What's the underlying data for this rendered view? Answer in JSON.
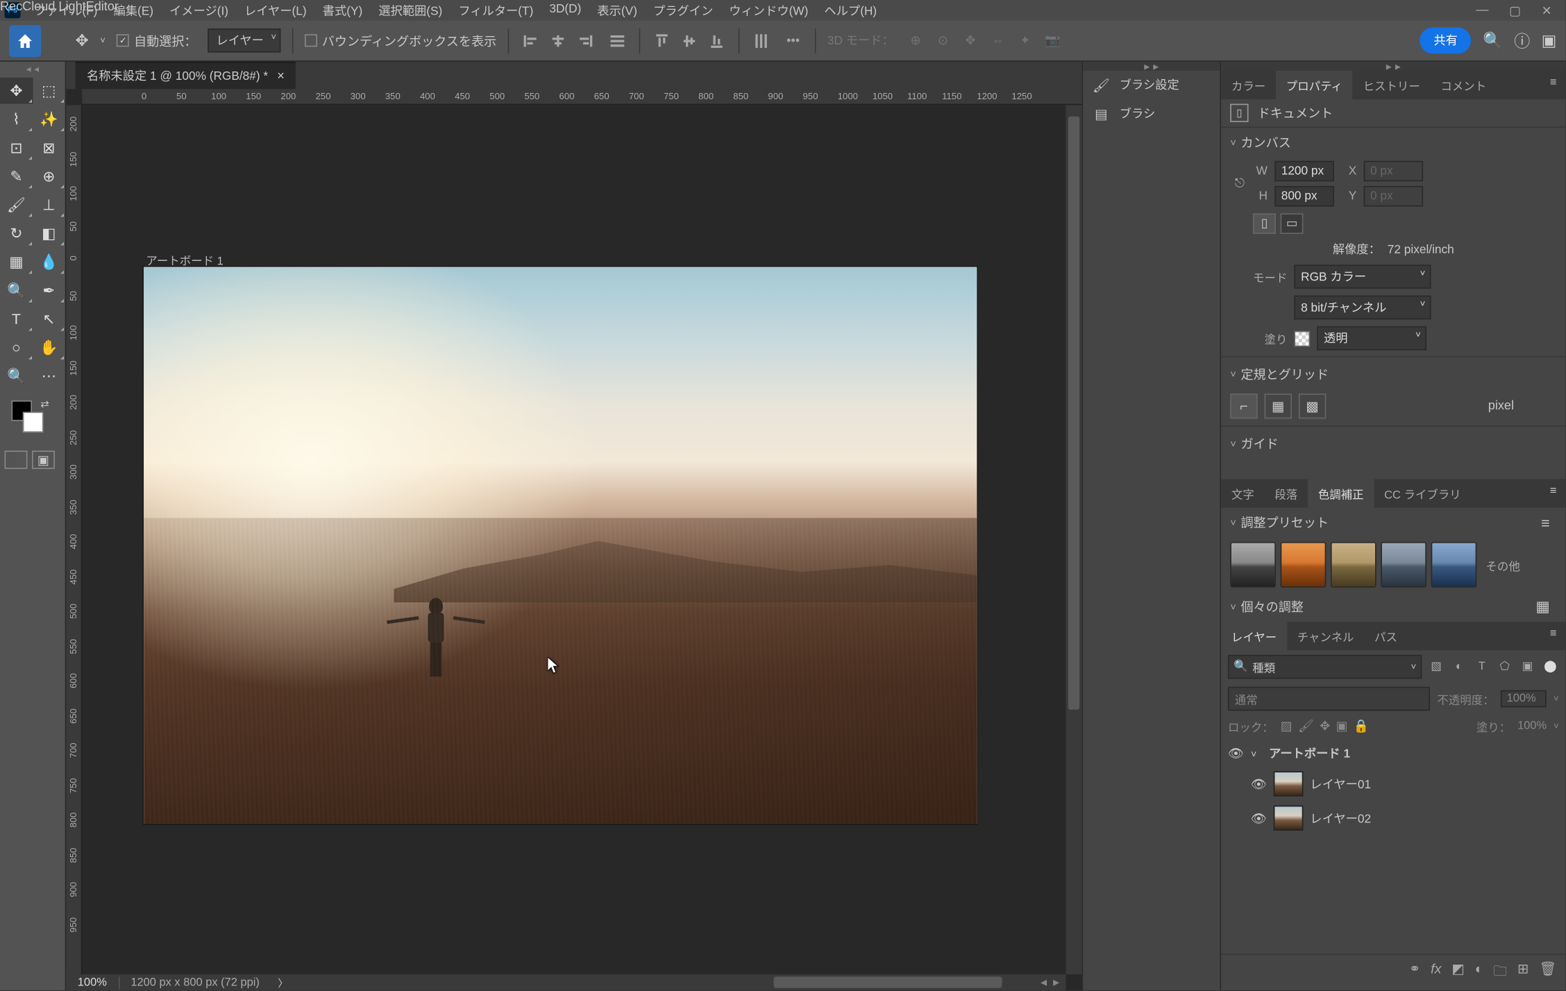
{
  "app": {
    "brand": "RecCloud LightEditor",
    "icon_label": "Ps"
  },
  "menu": [
    "ファイル(F)",
    "編集(E)",
    "イメージ(I)",
    "レイヤー(L)",
    "書式(Y)",
    "選択範囲(S)",
    "フィルター(T)",
    "3D(D)",
    "表示(V)",
    "プラグイン",
    "ウィンドウ(W)",
    "ヘルプ(H)"
  ],
  "options": {
    "auto_select": "自動選択：",
    "target_dropdown": "レイヤー",
    "show_bbox": "バウンディングボックスを表示",
    "threed_mode": "3D モード：",
    "share": "共有"
  },
  "document": {
    "tab_title": "名称未設定 1 @ 100% (RGB/8#) *",
    "artboard_label": "アートボード 1",
    "zoom": "100%",
    "status_dims": "1200 px x 800 px (72 ppi)"
  },
  "ruler_h": [
    "0",
    "50",
    "100",
    "150",
    "200",
    "250",
    "300",
    "350",
    "400",
    "450",
    "500",
    "550",
    "600",
    "650",
    "700",
    "750",
    "800",
    "850",
    "900",
    "950",
    "1000",
    "1050",
    "1100",
    "1150",
    "1200",
    "1250"
  ],
  "ruler_v": [
    "200",
    "150",
    "100",
    "50",
    "0",
    "50",
    "100",
    "150",
    "200",
    "250",
    "300",
    "350",
    "400",
    "450",
    "500",
    "550",
    "600",
    "650",
    "700",
    "750",
    "800",
    "850",
    "900",
    "950"
  ],
  "mid_panel": {
    "brush_settings": "ブラシ設定",
    "brush": "ブラシ"
  },
  "properties": {
    "tabs": [
      "カラー",
      "プロパティ",
      "ヒストリー",
      "コメント"
    ],
    "doc_label": "ドキュメント",
    "canvas_section": "カンバス",
    "w_label": "W",
    "w_value": "1200 px",
    "h_label": "H",
    "h_value": "800 px",
    "x_label": "X",
    "x_value": "0 px",
    "y_label": "Y",
    "y_value": "0 px",
    "resolution_label": "解像度：",
    "resolution_value": "72 pixel/inch",
    "mode_label": "モード",
    "mode_value": "RGB カラー",
    "depth_value": "8 bit/チャンネル",
    "fill_label": "塗り",
    "fill_value": "透明",
    "rulers_section": "定規とグリッド",
    "unit": "pixel",
    "guides_section": "ガイド"
  },
  "adjustments": {
    "tabs": [
      "文字",
      "段落",
      "色調補正",
      "CC ライブラリ"
    ],
    "presets_header": "調整プリセット",
    "more": "その他",
    "individual_header": "個々の調整"
  },
  "layers": {
    "tabs": [
      "レイヤー",
      "チャンネル",
      "パス"
    ],
    "filter_type": "種類",
    "blend_mode": "通常",
    "opacity_label": "不透明度：",
    "opacity_value": "100%",
    "lock_label": "ロック：",
    "fill_label": "塗り：",
    "fill_value": "100%",
    "artboard_name": "アートボード 1",
    "layer1": "レイヤー01",
    "layer2": "レイヤー02"
  }
}
